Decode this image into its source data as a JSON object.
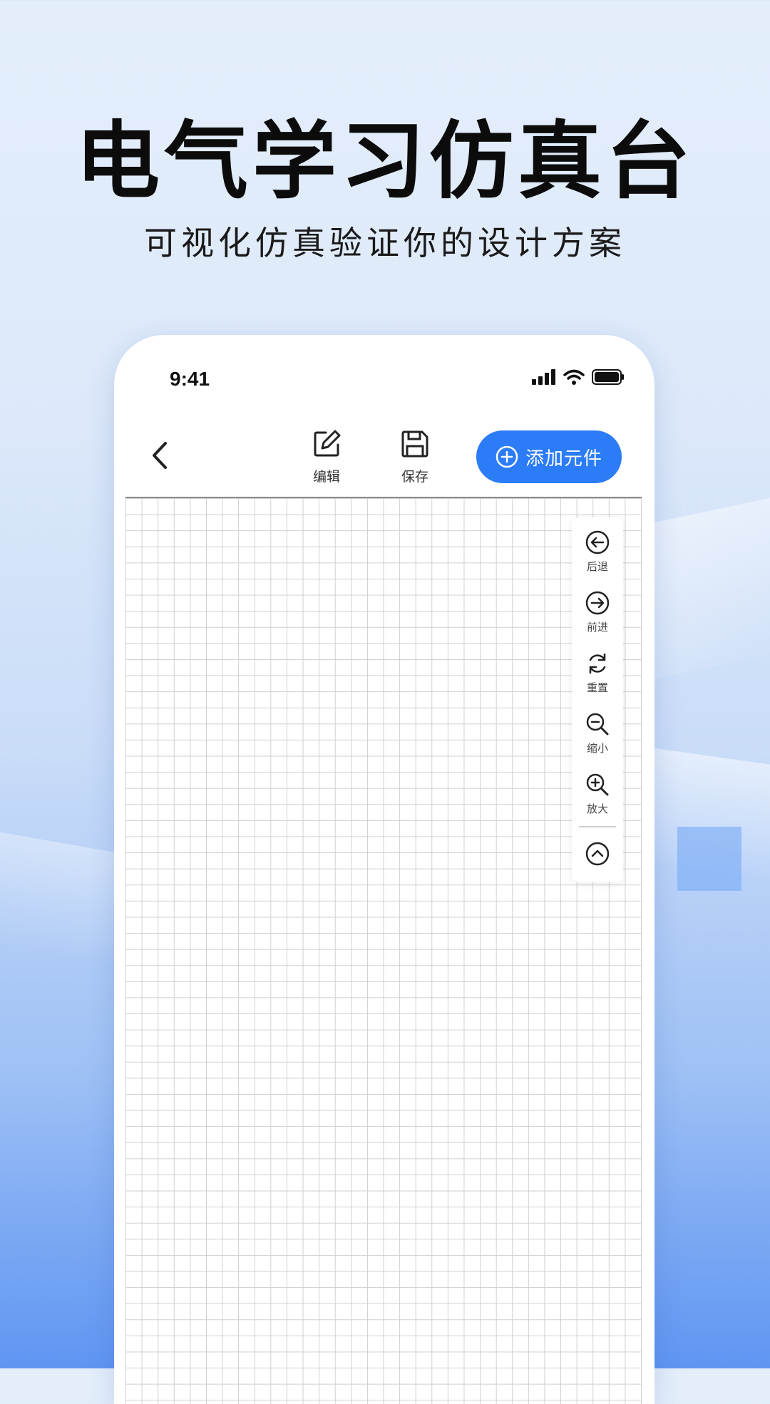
{
  "promo": {
    "title": "电气学习仿真台",
    "subtitle": "可视化仿真验证你的设计方案"
  },
  "status_bar": {
    "time": "9:41",
    "icons": [
      "signal-icon",
      "wifi-icon",
      "battery-icon"
    ]
  },
  "toolbar": {
    "back_icon": "chevron-left-icon",
    "edit_label": "编辑",
    "save_label": "保存",
    "add_label": "添加元件",
    "accent_color": "#2b7cf6"
  },
  "side_tools": {
    "items": [
      {
        "label": "后退",
        "icon": "arrow-left-circle-icon"
      },
      {
        "label": "前进",
        "icon": "arrow-right-circle-icon"
      },
      {
        "label": "重置",
        "icon": "refresh-icon"
      },
      {
        "label": "缩小",
        "icon": "zoom-out-icon"
      },
      {
        "label": "放大",
        "icon": "zoom-in-icon"
      }
    ],
    "collapse_icon": "chevron-up-circle-icon"
  }
}
